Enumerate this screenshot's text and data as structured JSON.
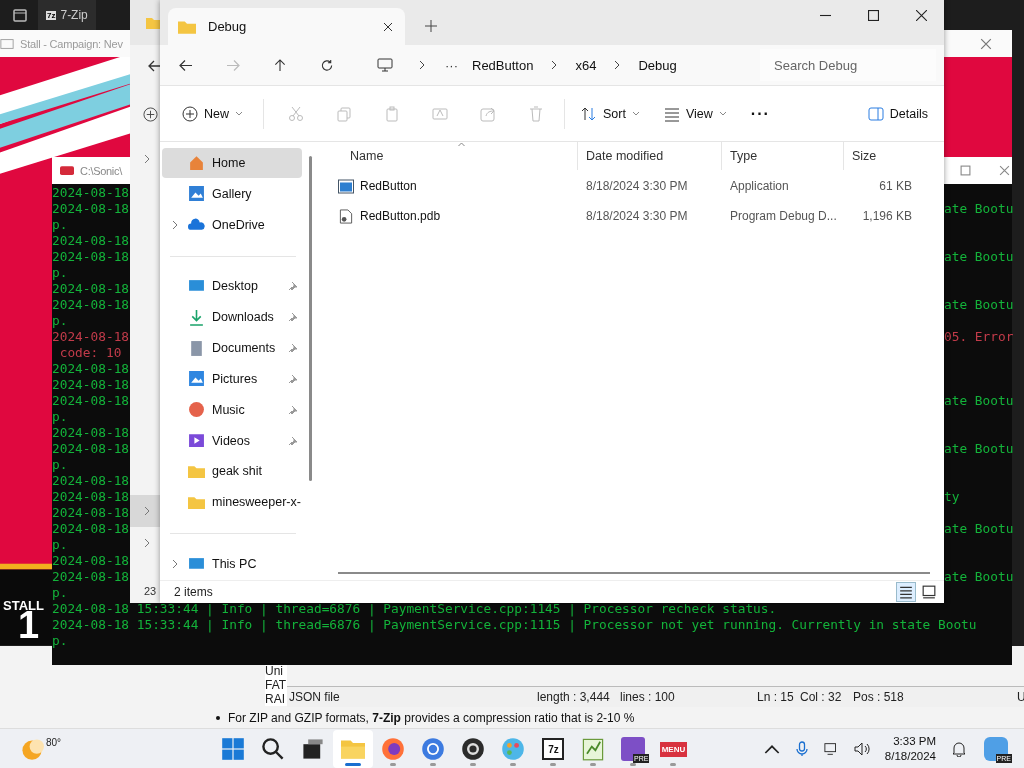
{
  "top_tab": {
    "icon_text": "7z",
    "title": "7-Zip"
  },
  "game_window": {
    "title": "Stall - Campaign: Nev",
    "banner": "STALL",
    "number": "1"
  },
  "console": {
    "title": "C:\\Sonic\\",
    "lines": [
      {
        "left": "2024-08-18",
        "kind": "info"
      },
      {
        "left": "2024-08-18",
        "right": "ate Bootu",
        "kind": "info"
      },
      {
        "left": "p.",
        "kind": "info"
      },
      {
        "left": "2024-08-18",
        "kind": "info"
      },
      {
        "left": "2024-08-18",
        "right": "ate Bootu",
        "kind": "info"
      },
      {
        "left": "p.",
        "kind": "info"
      },
      {
        "left": "2024-08-18",
        "kind": "info"
      },
      {
        "left": "2024-08-18",
        "right": "ate Bootu",
        "kind": "info"
      },
      {
        "left": "p.",
        "kind": "info"
      },
      {
        "left": "2024-08-18",
        "right": "05. Error",
        "kind": "error"
      },
      {
        "left": " code: 10",
        "kind": "error"
      },
      {
        "left": "2024-08-18",
        "kind": "info"
      },
      {
        "left": "2024-08-18",
        "kind": "info"
      },
      {
        "left": "2024-08-18",
        "right": "ate Bootu",
        "kind": "info"
      },
      {
        "left": "p.",
        "kind": "info"
      },
      {
        "left": "2024-08-18",
        "kind": "info"
      },
      {
        "left": "2024-08-18",
        "right": "ate Bootu",
        "kind": "info"
      },
      {
        "left": "p.",
        "kind": "info"
      },
      {
        "left": "2024-08-18",
        "kind": "info"
      },
      {
        "left": "2024-08-18",
        "right": "ty",
        "kind": "info"
      },
      {
        "left": "2024-08-18",
        "kind": "info"
      },
      {
        "left": "2024-08-18",
        "right": "ate Bootu",
        "kind": "info"
      },
      {
        "left": "p.",
        "kind": "info"
      },
      {
        "left": "2024-08-18",
        "kind": "info"
      },
      {
        "left": "2024-08-18",
        "right": "ate Bootu",
        "kind": "info"
      },
      {
        "left": "p.",
        "kind": "info"
      },
      {
        "full": "2024-08-18 15:33:44 | Info | thread=6876 | PaymentService.cpp:1145 | Processor recheck status.",
        "kind": "info"
      },
      {
        "full": "2024-08-18 15:33:44 | Info | thread=6876 | PaymentService.cpp:1115 | Processor not yet running. Currently in state Bootu",
        "kind": "info"
      },
      {
        "full": "p.",
        "kind": "info"
      }
    ]
  },
  "back_window": {
    "count": "23"
  },
  "explorer": {
    "tab": "Debug",
    "breadcrumb": [
      "RedButton",
      "x64",
      "Debug"
    ],
    "more": "···",
    "search": {
      "placeholder": "Search Debug"
    },
    "toolbar": {
      "new": "New",
      "sort": "Sort",
      "view": "View",
      "more": "···",
      "details": "Details"
    },
    "sidebar": [
      {
        "label": "Home",
        "kind": "home",
        "selected": true,
        "pinned": false,
        "expandable": false
      },
      {
        "label": "Gallery",
        "kind": "gallery",
        "selected": false,
        "pinned": false,
        "expandable": false
      },
      {
        "label": "OneDrive",
        "kind": "cloud",
        "selected": false,
        "pinned": false,
        "expandable": true
      },
      {
        "kind": "divider"
      },
      {
        "label": "Desktop",
        "kind": "desktop",
        "selected": false,
        "pinned": true,
        "expandable": false
      },
      {
        "label": "Downloads",
        "kind": "download",
        "selected": false,
        "pinned": true,
        "expandable": false
      },
      {
        "label": "Documents",
        "kind": "document",
        "selected": false,
        "pinned": true,
        "expandable": false
      },
      {
        "label": "Pictures",
        "kind": "pictures",
        "selected": false,
        "pinned": true,
        "expandable": false
      },
      {
        "label": "Music",
        "kind": "music",
        "selected": false,
        "pinned": true,
        "expandable": false
      },
      {
        "label": "Videos",
        "kind": "videos",
        "selected": false,
        "pinned": true,
        "expandable": false
      },
      {
        "label": "geak shit",
        "kind": "folder",
        "selected": false,
        "pinned": false,
        "expandable": false
      },
      {
        "label": "minesweeper-x-",
        "kind": "folder",
        "selected": false,
        "pinned": false,
        "expandable": false
      },
      {
        "kind": "divider"
      },
      {
        "label": "This PC",
        "kind": "pc",
        "selected": false,
        "pinned": false,
        "expandable": true
      }
    ],
    "columns": [
      "Name",
      "Date modified",
      "Type",
      "Size"
    ],
    "files": [
      {
        "name": "RedButton",
        "date": "8/18/2024 3:30 PM",
        "type": "Application",
        "size": "61 KB",
        "kind": "app"
      },
      {
        "name": "RedButton.pdb",
        "date": "8/18/2024 3:30 PM",
        "type": "Program Debug D...",
        "size": "1,196 KB",
        "kind": "file"
      }
    ],
    "status": "2 items"
  },
  "document": {
    "lines": [
      "Uni",
      "FAT",
      "RAI"
    ],
    "bullet": "For ZIP and GZIP formats, **7-Zip** provides a compression ratio that is 2-10 %",
    "status": [
      "JSON file",
      "length : 3,444",
      "lines : 100",
      "Ln : 15",
      "Col : 32",
      "Pos : 518",
      "U"
    ]
  },
  "taskbar": {
    "weather": "80°",
    "apps": [
      {
        "kind": "folder",
        "selected": true
      },
      {
        "kind": "firefox",
        "selected": false
      },
      {
        "kind": "chrome",
        "selected": false
      },
      {
        "kind": "obs",
        "selected": false
      },
      {
        "kind": "paint",
        "selected": false
      },
      {
        "kind": "sevenzip",
        "label": "7z",
        "selected": false
      },
      {
        "kind": "notepad",
        "selected": false
      },
      {
        "kind": "vs",
        "label": "PRE",
        "selected": false
      },
      {
        "kind": "menu",
        "label": "MENU",
        "selected": false
      }
    ],
    "time": "3:33 PM",
    "date": "8/18/2024",
    "copilot_badge": "PRE"
  }
}
